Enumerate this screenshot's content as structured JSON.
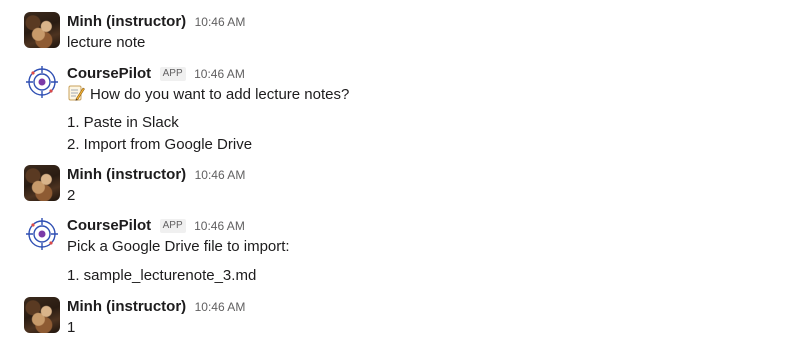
{
  "messages": [
    {
      "author": "Minh (instructor)",
      "time": "10:46 AM",
      "lines": [
        "lecture note"
      ]
    },
    {
      "author": "CoursePilot",
      "badge": "APP",
      "time": "10:46 AM",
      "lines": [
        "How do you want to add lecture notes?",
        "1. Paste in Slack",
        "2. Import from Google Drive"
      ],
      "emoji_icon": "memo-icon"
    },
    {
      "author": "Minh (instructor)",
      "time": "10:46 AM",
      "lines": [
        "2"
      ]
    },
    {
      "author": "CoursePilot",
      "badge": "APP",
      "time": "10:46 AM",
      "lines": [
        "Pick a Google Drive file to import:",
        "1. sample_lecturenote_3.md"
      ]
    },
    {
      "author": "Minh (instructor)",
      "time": "10:46 AM",
      "lines": [
        "1"
      ]
    }
  ],
  "colors": {
    "text": "#1d1c1d",
    "muted": "#616061",
    "bot_ring": "#2f4fb3",
    "bot_center": "#7b3aa8"
  }
}
